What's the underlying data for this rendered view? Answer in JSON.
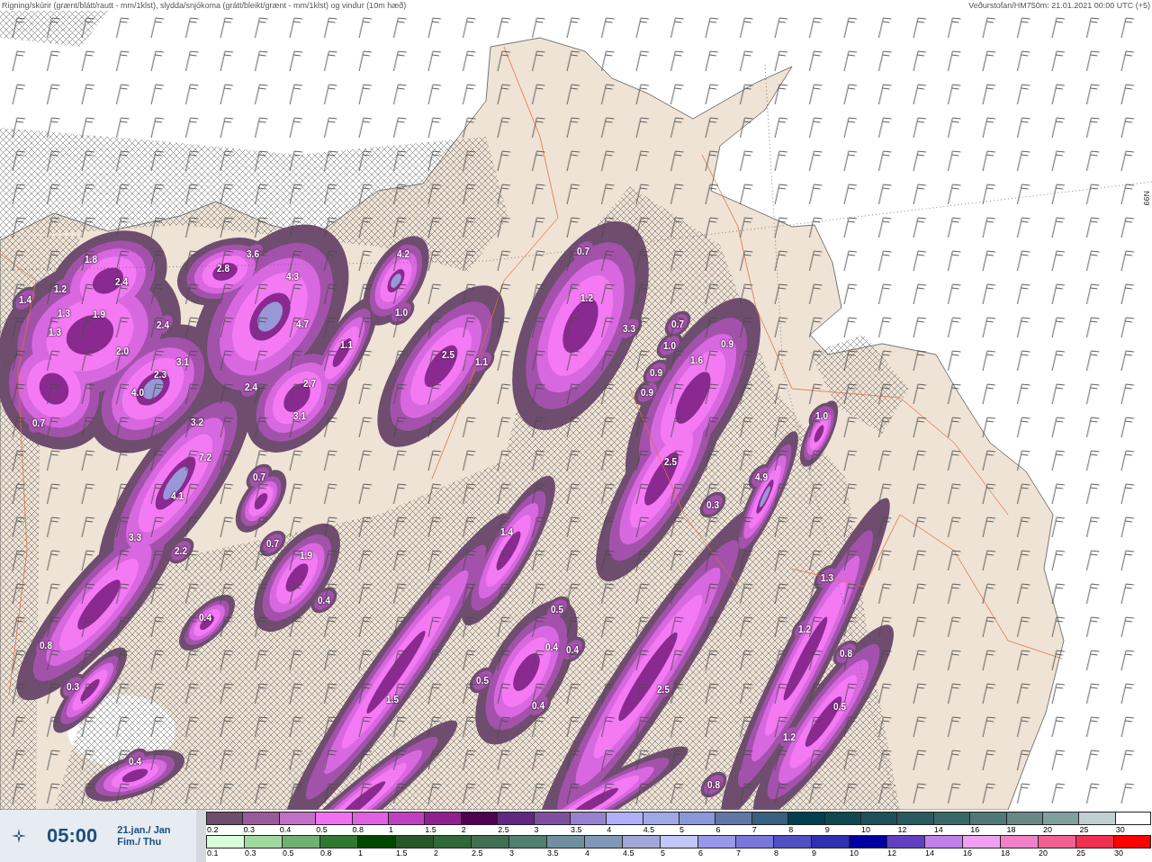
{
  "header": {
    "title": "Rigning/skúrir (grænt/blátt/rautt - mm/1klst), slydda/snjókoma (grátt/bleikt/grænt - mm/1klst) og vindur (10m hæð)",
    "source": "Veðurstofan/HM750m: 21.01.2021 00:00 UTC (+5)"
  },
  "map": {
    "grid_label": "66N",
    "values": [
      "1.8",
      "1.2",
      "2.4",
      "1.4",
      "1.3",
      "1.9",
      "1.3",
      "2.4",
      "2.0",
      "3.1",
      "2.3",
      "4.0",
      "0.7",
      "2.8",
      "3.6",
      "4.3",
      "4.7",
      "4.2",
      "1.0",
      "1.1",
      "2.4",
      "2.7",
      "3.1",
      "3.2",
      "7.2",
      "0.7",
      "4.1",
      "3.3",
      "2.2",
      "0.7",
      "1.9",
      "0.4",
      "0.4",
      "0.8",
      "0.3",
      "0.4",
      "0.7",
      "1.2",
      "2.5",
      "1.1",
      "3.3",
      "0.7",
      "1.0",
      "0.9",
      "1.6",
      "0.9",
      "0.9",
      "1.0",
      "2.5",
      "4.9",
      "0.3",
      "1.4",
      "0.5",
      "0.4",
      "0.4",
      "0.5",
      "0.4",
      "1.5",
      "2.5",
      "1.3",
      "1.2",
      "0.8",
      "0.5",
      "1.2",
      "0.8"
    ]
  },
  "time_box": {
    "time": "05:00",
    "date": "21.jan./ Jan",
    "weekday": "Fim./ Thu"
  },
  "legends": [
    {
      "steps": [
        {
          "label": "0.2",
          "color": "#6e4d6e"
        },
        {
          "label": "0.3",
          "color": "#9a5a9a"
        },
        {
          "label": "0.4",
          "color": "#c070c8"
        },
        {
          "label": "0.5",
          "color": "#f070f0"
        },
        {
          "label": "0.8",
          "color": "#e060e0"
        },
        {
          "label": "1",
          "color": "#c040c0"
        },
        {
          "label": "1.5",
          "color": "#902090"
        },
        {
          "label": "2",
          "color": "#500050"
        },
        {
          "label": "2.5",
          "color": "#602880"
        },
        {
          "label": "3",
          "color": "#8050a0"
        },
        {
          "label": "3.5",
          "color": "#9a80d0"
        },
        {
          "label": "4",
          "color": "#b0b0f8"
        },
        {
          "label": "4.5",
          "color": "#a0a8e8"
        },
        {
          "label": "5",
          "color": "#8898d8"
        },
        {
          "label": "6",
          "color": "#6078a8"
        },
        {
          "label": "7",
          "color": "#386080"
        },
        {
          "label": "8",
          "color": "#004050"
        },
        {
          "label": "9",
          "color": "#104850"
        },
        {
          "label": "10",
          "color": "#1d5058"
        },
        {
          "label": "12",
          "color": "#2a5a60"
        },
        {
          "label": "14",
          "color": "#3a6868"
        },
        {
          "label": "16",
          "color": "#507878"
        },
        {
          "label": "18",
          "color": "#688888"
        },
        {
          "label": "20",
          "color": "#80a0a0"
        },
        {
          "label": "25",
          "color": "#c0d0d0"
        },
        {
          "label": "30",
          "color": "#ffffff"
        }
      ]
    },
    {
      "steps": [
        {
          "label": "0.1",
          "color": "#d8ffd8"
        },
        {
          "label": "0.3",
          "color": "#a0d8a0"
        },
        {
          "label": "0.5",
          "color": "#70b070"
        },
        {
          "label": "0.8",
          "color": "#307830"
        },
        {
          "label": "1",
          "color": "#004800"
        },
        {
          "label": "1.5",
          "color": "#285828"
        },
        {
          "label": "2",
          "color": "#306838"
        },
        {
          "label": "2.5",
          "color": "#407050"
        },
        {
          "label": "3",
          "color": "#508070"
        },
        {
          "label": "3.5",
          "color": "#7090a0"
        },
        {
          "label": "4",
          "color": "#8098b8"
        },
        {
          "label": "4.5",
          "color": "#a0a8d8"
        },
        {
          "label": "5",
          "color": "#c0c8f8"
        },
        {
          "label": "6",
          "color": "#9898e8"
        },
        {
          "label": "7",
          "color": "#7878d8"
        },
        {
          "label": "8",
          "color": "#5050c0"
        },
        {
          "label": "9",
          "color": "#3030b0"
        },
        {
          "label": "10",
          "color": "#0000a0"
        },
        {
          "label": "12",
          "color": "#6040c0"
        },
        {
          "label": "14",
          "color": "#c080e8"
        },
        {
          "label": "16",
          "color": "#f0a0f0"
        },
        {
          "label": "18",
          "color": "#f080c8"
        },
        {
          "label": "20",
          "color": "#f06090"
        },
        {
          "label": "25",
          "color": "#f03050"
        },
        {
          "label": "30",
          "color": "#ff0000"
        }
      ]
    }
  ]
}
